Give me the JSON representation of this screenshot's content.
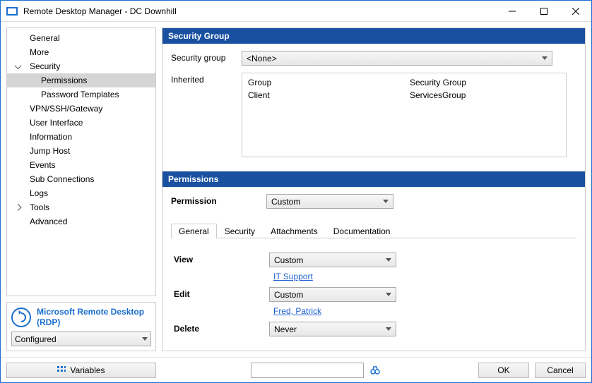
{
  "window": {
    "title": "Remote Desktop Manager - DC Downhill"
  },
  "nav": {
    "items": [
      {
        "label": "General"
      },
      {
        "label": "More"
      },
      {
        "label": "Security"
      },
      {
        "label": "Permissions"
      },
      {
        "label": "Password Templates"
      },
      {
        "label": "VPN/SSH/Gateway"
      },
      {
        "label": "User Interface"
      },
      {
        "label": "Information"
      },
      {
        "label": "Jump Host"
      },
      {
        "label": "Events"
      },
      {
        "label": "Sub Connections"
      },
      {
        "label": "Logs"
      },
      {
        "label": "Tools"
      },
      {
        "label": "Advanced"
      }
    ]
  },
  "info": {
    "type_label": "Microsoft Remote Desktop (RDP)",
    "status": "Configured"
  },
  "security_group": {
    "header": "Security Group",
    "label": "Security group",
    "value": "<None>",
    "inherited_label": "Inherited",
    "col1_header": "Group",
    "col2_header": "Security Group",
    "rows": [
      {
        "group": "Client",
        "sg": "ServicesGroup"
      }
    ]
  },
  "permissions": {
    "header": "Permissions",
    "label": "Permission",
    "value": "Custom",
    "tabs": [
      "General",
      "Security",
      "Attachments",
      "Documentation"
    ],
    "view": {
      "label": "View",
      "value": "Custom",
      "who": "IT Support"
    },
    "edit": {
      "label": "Edit",
      "value": "Custom",
      "who": "Fred, Patrick"
    },
    "delete": {
      "label": "Delete",
      "value": "Never"
    }
  },
  "footer": {
    "variables": "Variables",
    "ok": "OK",
    "cancel": "Cancel"
  }
}
